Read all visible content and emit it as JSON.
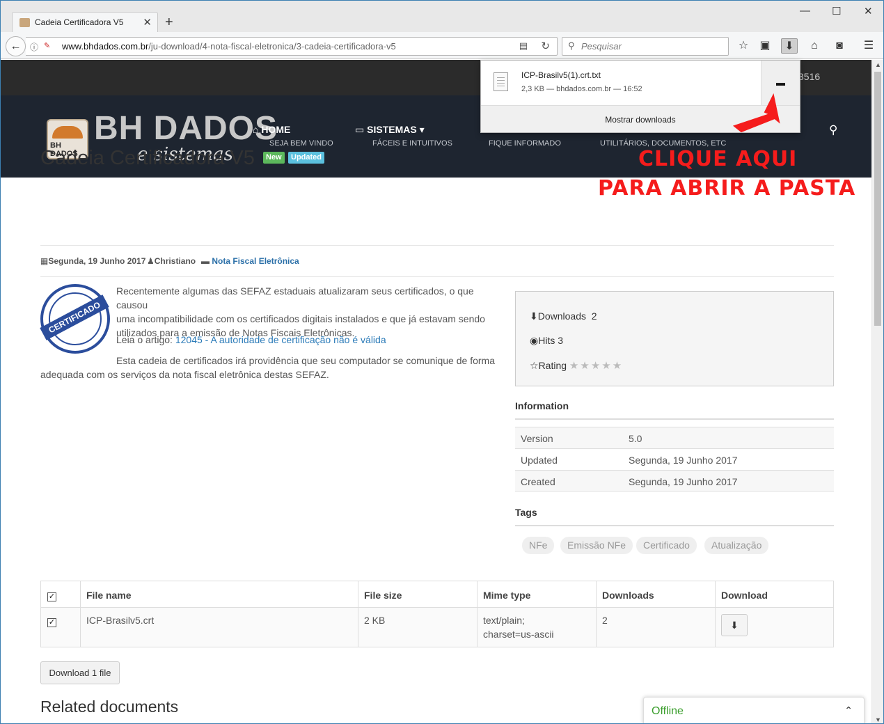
{
  "browser": {
    "tab_title": "Cadeia Certificadora V5",
    "url_host": "www.bhdados.com.br",
    "url_path": "/ju-download/4-nota-fiscal-eletronica/3-cadeia-certificadora-v5",
    "search_placeholder": "Pesquisar"
  },
  "download_panel": {
    "file_name": "ICP-Brasilv5(1).crt.txt",
    "details": "2,3 KB — bhdados.com.br — 16:52",
    "show_downloads": "Mostrar downloads"
  },
  "site": {
    "phone_fragment": "3516",
    "logo_main": "BH DADOS",
    "logo_sub": "e sistemas",
    "logo_box_text": "BH DADOS",
    "menu": [
      {
        "label": "HOME",
        "sub": "SEJA BEM VINDO"
      },
      {
        "label": "SISTEMAS",
        "sub": "FÁCEIS E INTUITIVOS"
      },
      {
        "label": "",
        "sub": "FIQUE INFORMADO"
      },
      {
        "label": "",
        "sub": "UTILITÁRIOS, DOCUMENTOS, ETC"
      }
    ]
  },
  "document": {
    "title": "Cadeia Certificadora V5",
    "badge_new": "New",
    "badge_updated": "Updated",
    "date": "Segunda, 19 Junho 2017",
    "author": "Christiano",
    "category": "Nota Fiscal Eletrônica",
    "seal_text": "CERTIFICADO",
    "para1_line1": "Recentemente algumas das SEFAZ estaduais atualizaram seus certificados, o que causou",
    "para1_line2": "uma incompatibilidade com os certificados digitais instalados e que já estavam sendo",
    "para1_line3": "utilizados para a emissão de Notas Fiscais Eletrônicas.",
    "read_label": "Leia o artigo:",
    "read_link": "12045 - A autoridade de certificação não é válida",
    "para2_line1": "Esta cadeia de certificados irá providência que seu computador se comunique de forma",
    "para2_line2": "adequada com os serviços da nota fiscal eletrônica destas SEFAZ."
  },
  "stats": {
    "downloads_label": "Downloads",
    "downloads_value": "2",
    "hits_label": "Hits",
    "hits_value": "3",
    "rating_label": "Rating",
    "rating_value": 0,
    "rating_max": 5
  },
  "information": {
    "heading": "Information",
    "rows": [
      {
        "key": "Version",
        "value": "5.0"
      },
      {
        "key": "Updated",
        "value": "Segunda, 19 Junho 2017"
      },
      {
        "key": "Created",
        "value": "Segunda, 19 Junho 2017"
      }
    ]
  },
  "tags": {
    "heading": "Tags",
    "items": [
      "NFe",
      "Emissão NFe",
      "Certificado",
      "Atualização"
    ]
  },
  "files": {
    "headers": [
      "File name",
      "File size",
      "Mime type",
      "Downloads",
      "Download"
    ],
    "rows": [
      {
        "name": "ICP-Brasilv5.crt",
        "size": "2 KB",
        "mime_line1": "text/plain;",
        "mime_line2": "charset=us-ascii",
        "downloads": "2"
      }
    ],
    "download_button": "Download 1 file"
  },
  "related_heading": "Related documents",
  "chat": {
    "status": "Offline"
  },
  "annotation": {
    "line1": "CLIQUE AQUI",
    "line2": "PARA ABRIR A PASTA",
    "color": "#f51c1c"
  }
}
